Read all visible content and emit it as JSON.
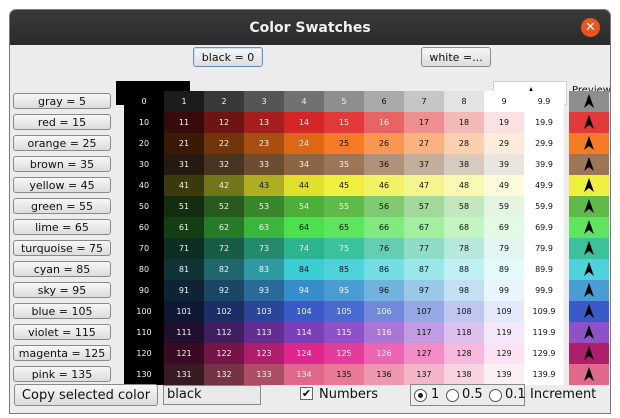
{
  "window": {
    "title": "Color Swatches"
  },
  "toolbar": {
    "black_button": "black = 0",
    "white_button": "white =...",
    "preview_label": "Preview"
  },
  "rows": [
    {
      "button": "gray = 5",
      "last": "9.9",
      "nums": [
        "0",
        "1",
        "2",
        "3",
        "4",
        "5",
        "6",
        "7",
        "8",
        "9"
      ],
      "colors": [
        "#000000",
        "#1c1c1c",
        "#393939",
        "#555555",
        "#717171",
        "#8e8e8e",
        "#aaaaaa",
        "#c6c6c6",
        "#e3e3e3",
        "#ffffff"
      ],
      "preview": "#8e8e8e",
      "arrow": "#000000"
    },
    {
      "button": "red = 15",
      "last": "19.9",
      "nums": [
        "10",
        "11",
        "12",
        "13",
        "14",
        "15",
        "16",
        "17",
        "18",
        "19"
      ],
      "colors": [
        "#000000",
        "#380a0a",
        "#6f1414",
        "#a51d1d",
        "#d42626",
        "#e23a3a",
        "#e86464",
        "#ee8e8e",
        "#f4b8b8",
        "#fae2e2"
      ],
      "preview": "#e23a3a",
      "arrow": "#000000"
    },
    {
      "button": "orange = 25",
      "last": "29.9",
      "nums": [
        "20",
        "21",
        "22",
        "23",
        "24",
        "25",
        "26",
        "27",
        "28",
        "29"
      ],
      "colors": [
        "#000000",
        "#3a1a05",
        "#72340a",
        "#aa4d10",
        "#de6615",
        "#f77b24",
        "#f99752",
        "#fab380",
        "#fccfae",
        "#feebdc"
      ],
      "preview": "#f77b24",
      "arrow": "#000000"
    },
    {
      "button": "brown = 35",
      "last": "39.9",
      "nums": [
        "30",
        "31",
        "32",
        "33",
        "34",
        "35",
        "36",
        "37",
        "38",
        "39"
      ],
      "colors": [
        "#000000",
        "#241a11",
        "#483421",
        "#6c4d32",
        "#8c6543",
        "#9d7658",
        "#b0927a",
        "#c3ae9d",
        "#d7cabf",
        "#ebe5df"
      ],
      "preview": "#9d7658",
      "arrow": "#000000"
    },
    {
      "button": "yellow = 45",
      "last": "49.9",
      "nums": [
        "40",
        "41",
        "42",
        "43",
        "44",
        "45",
        "46",
        "47",
        "48",
        "49"
      ],
      "colors": [
        "#000000",
        "#3a3a0c",
        "#747418",
        "#aeae23",
        "#e0e02c",
        "#efef40",
        "#f2f266",
        "#f5f58d",
        "#f9f9b4",
        "#fcfcdc"
      ],
      "preview": "#efef40",
      "arrow": "#000000"
    },
    {
      "button": "green = 55",
      "last": "59.9",
      "nums": [
        "50",
        "51",
        "52",
        "53",
        "54",
        "55",
        "56",
        "57",
        "58",
        "59"
      ],
      "colors": [
        "#000000",
        "#132d0e",
        "#275a1c",
        "#3a872b",
        "#4daf38",
        "#5fba4a",
        "#80ca72",
        "#a2d99a",
        "#c3e7be",
        "#e4f5e2"
      ],
      "preview": "#5fba4a",
      "arrow": "#000000"
    },
    {
      "button": "lime = 65",
      "last": "69.9",
      "nums": [
        "60",
        "61",
        "62",
        "63",
        "64",
        "65",
        "66",
        "67",
        "68",
        "69"
      ],
      "colors": [
        "#000000",
        "#133d13",
        "#277a27",
        "#3ab63a",
        "#4ce04c",
        "#5fe45f",
        "#80ea80",
        "#a2efa2",
        "#c3f5c3",
        "#e4fae4"
      ],
      "preview": "#5fe45f",
      "arrow": "#000000"
    },
    {
      "button": "turquoise = 75",
      "last": "79.9",
      "nums": [
        "70",
        "71",
        "72",
        "73",
        "74",
        "75",
        "76",
        "77",
        "78",
        "79"
      ],
      "colors": [
        "#000000",
        "#0c2e24",
        "#185c48",
        "#238a6b",
        "#2cb48d",
        "#3bc29b",
        "#64cfb0",
        "#8edcc6",
        "#b8e8db",
        "#e2f5f0"
      ],
      "preview": "#3bc29b",
      "arrow": "#000000"
    },
    {
      "button": "cyan = 85",
      "last": "89.9",
      "nums": [
        "80",
        "81",
        "82",
        "83",
        "84",
        "85",
        "86",
        "87",
        "88",
        "89"
      ],
      "colors": [
        "#000000",
        "#103436",
        "#1f676c",
        "#2e9ba2",
        "#3cccd4",
        "#4fd3da",
        "#74dde3",
        "#9ae7eb",
        "#bff0f3",
        "#e4fafb"
      ],
      "preview": "#4fd3da",
      "arrow": "#000000"
    },
    {
      "button": "sky = 95",
      "last": "99.9",
      "nums": [
        "90",
        "91",
        "92",
        "93",
        "94",
        "95",
        "96",
        "97",
        "98",
        "99"
      ],
      "colors": [
        "#000000",
        "#0d2434",
        "#1b4767",
        "#286b9b",
        "#358ecb",
        "#4a9cd3",
        "#72b3de",
        "#9ac9e8",
        "#c2e0f2",
        "#e9f5fc"
      ],
      "preview": "#4a9cd3",
      "arrow": "#000000"
    },
    {
      "button": "blue = 105",
      "last": "109.9",
      "nums": [
        "100",
        "101",
        "102",
        "103",
        "104",
        "105",
        "106",
        "107",
        "108",
        "109"
      ],
      "colors": [
        "#000000",
        "#0e1733",
        "#1c2e66",
        "#2a4599",
        "#3a5bc7",
        "#4b6ad0",
        "#7189db",
        "#97a8e6",
        "#bdc7f0",
        "#e3e8fa"
      ],
      "preview": "#3a5bc7",
      "arrow": "#000000"
    },
    {
      "button": "violet = 115",
      "last": "119.9",
      "nums": [
        "110",
        "111",
        "112",
        "113",
        "114",
        "115",
        "116",
        "117",
        "118",
        "119"
      ],
      "colors": [
        "#000000",
        "#201030",
        "#401f60",
        "#602f90",
        "#7d3eba",
        "#8e52c8",
        "#a877d5",
        "#c29ce2",
        "#dcc1ee",
        "#f4e8fa"
      ],
      "preview": "#8e52c8",
      "arrow": "#000000"
    },
    {
      "button": "magenta = 125",
      "last": "129.9",
      "nums": [
        "120",
        "121",
        "122",
        "123",
        "124",
        "125",
        "126",
        "127",
        "128",
        "129"
      ],
      "colors": [
        "#000000",
        "#3a0a24",
        "#741448",
        "#ae1e6c",
        "#de268c",
        "#e53c9c",
        "#eb65b2",
        "#f18ec8",
        "#f6b8dd",
        "#fce2f2"
      ],
      "preview": "#ae1e6c",
      "arrow": "#000000"
    },
    {
      "button": "pink = 135",
      "last": "139.9",
      "nums": [
        "130",
        "131",
        "132",
        "133",
        "134",
        "135",
        "136",
        "137",
        "138",
        "139"
      ],
      "colors": [
        "#000000",
        "#3a1a22",
        "#743444",
        "#ae4e66",
        "#e0688a",
        "#e87a98",
        "#ee98b0",
        "#f3b6c8",
        "#f8d4de",
        "#fdf0f4"
      ],
      "preview": "#e0688a",
      "arrow": "#000000"
    }
  ],
  "bottom": {
    "copy_button": "Copy selected color",
    "selected_name": "black",
    "numbers_label": "Numbers",
    "numbers_checked": "✔",
    "increments": [
      "1",
      "0.5",
      "0.1"
    ],
    "increment_label": "Increment"
  },
  "colors": {
    "accent": "#e95420"
  }
}
